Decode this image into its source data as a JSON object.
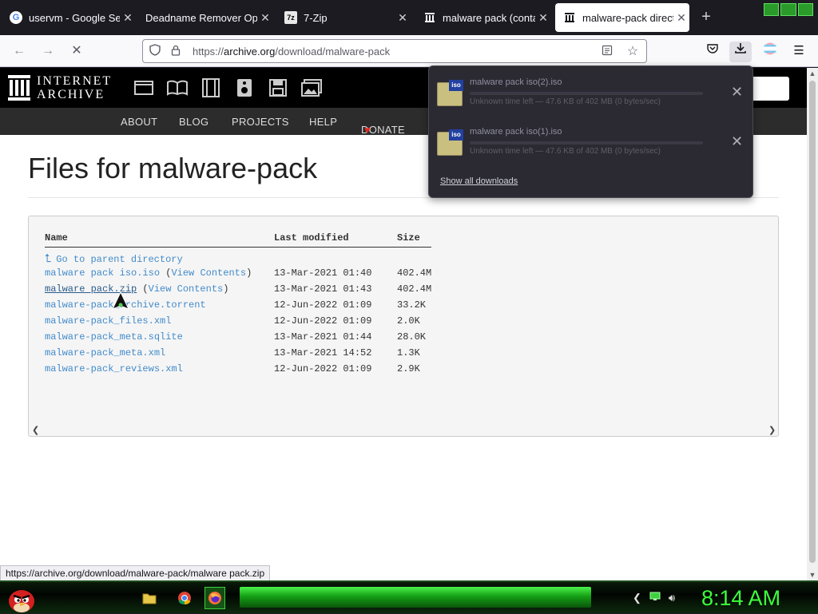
{
  "browser": {
    "tabs": [
      {
        "title": "uservm - Google Search",
        "favicon": "G",
        "active": false
      },
      {
        "title": "Deadname Remover Options",
        "favicon": "",
        "active": false
      },
      {
        "title": "7-Zip",
        "favicon": "7z",
        "active": false
      },
      {
        "title": "malware pack (contains",
        "favicon": "museum",
        "active": false
      },
      {
        "title": "malware-pack directory",
        "favicon": "museum",
        "active": true
      }
    ],
    "new_tab": "+",
    "url_prefix": "https://",
    "url_domain": "archive.org",
    "url_path": "/download/malware-pack"
  },
  "ia": {
    "logo_line1": "INTERNET",
    "logo_line2": "ARCHIVE",
    "nav": [
      "ABOUT",
      "BLOG",
      "PROJECTS",
      "HELP",
      "DONATE"
    ],
    "donate_heart": "♥"
  },
  "page": {
    "heading": "Files for malware-pack",
    "columns": {
      "name": "Name",
      "modified": "Last modified",
      "size": "Size"
    },
    "parent_link": "Go to parent directory",
    "files": [
      {
        "name": "malware pack iso.iso",
        "view": "View Contents",
        "modified": "13-Mar-2021 01:40",
        "size": "402.4M"
      },
      {
        "name": "malware pack.zip",
        "view": "View Contents",
        "modified": "13-Mar-2021 01:43",
        "size": "402.4M"
      },
      {
        "name": "malware-pack_archive.torrent",
        "view": "",
        "modified": "12-Jun-2022 01:09",
        "size": "33.2K"
      },
      {
        "name": "malware-pack_files.xml",
        "view": "",
        "modified": "12-Jun-2022 01:09",
        "size": "2.0K"
      },
      {
        "name": "malware-pack_meta.sqlite",
        "view": "",
        "modified": "13-Mar-2021 01:44",
        "size": "28.0K"
      },
      {
        "name": "malware-pack_meta.xml",
        "view": "",
        "modified": "13-Mar-2021 14:52",
        "size": "1.3K"
      },
      {
        "name": "malware-pack_reviews.xml",
        "view": "",
        "modified": "12-Jun-2022 01:09",
        "size": "2.9K"
      }
    ],
    "status_url": "https://archive.org/download/malware-pack/malware pack.zip"
  },
  "downloads": {
    "items": [
      {
        "name": "malware pack iso(2).iso",
        "info": "Unknown time left — 47.6 KB of 402 MB (0 bytes/sec)",
        "badge": "iso"
      },
      {
        "name": "malware pack iso(1).iso",
        "info": "Unknown time left — 47.6 KB of 402 MB (0 bytes/sec)",
        "badge": "iso"
      }
    ],
    "show_all": "Show all downloads"
  },
  "taskbar": {
    "clock": "8:14 AM"
  }
}
